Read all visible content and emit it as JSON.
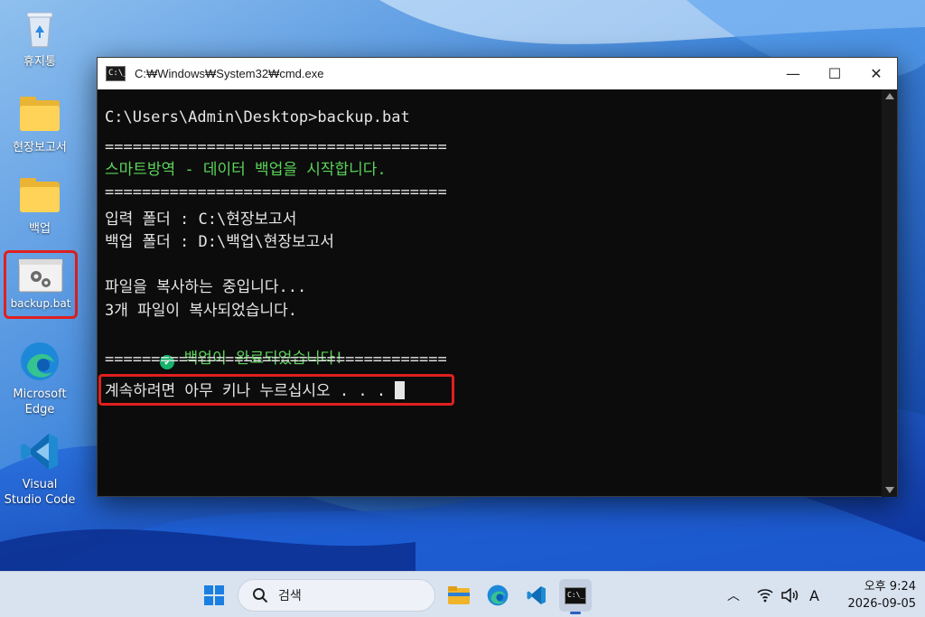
{
  "desktop": {
    "icons": [
      {
        "label": "휴지통",
        "glyph": "recycle-bin-icon"
      },
      {
        "label": "현장보고서",
        "glyph": "folder-icon"
      },
      {
        "label": "백업",
        "glyph": "folder-icon"
      },
      {
        "label": "backup.bat",
        "glyph": "batch-file-gears-icon",
        "selected": true
      },
      {
        "label": "Microsoft Edge",
        "glyph": "edge-icon"
      },
      {
        "label": "Visual Studio Code",
        "glyph": "vscode-icon"
      }
    ]
  },
  "window": {
    "title": "C:₩Windows₩System32₩cmd.exe",
    "icon_text": "C:\\_",
    "minimize_glyph": "—",
    "maximize_glyph": "☐",
    "close_glyph": "✕"
  },
  "terminal": {
    "prompt": "C:\\Users\\Admin\\Desktop>backup.bat",
    "separator": "=====================================",
    "banner": "스마트방역 - 데이터 백업을 시작합니다.",
    "input_folder": "입력 폴더 : C:\\현장보고서",
    "backup_folder": "백업 폴더 : D:\\백업\\현장보고서",
    "copying": "파일을 복사하는 중입니다...",
    "copied": "3개 파일이 복사되었습니다.",
    "done": "백업이 완료되었습니다!",
    "done_check": "✔",
    "continue_prompt": "계속하려면 아무 키나 누르십시오 . . . "
  },
  "taskbar": {
    "search_placeholder": "검색",
    "clock_time": "오후 9:24",
    "clock_date": "2026-09-05",
    "ime_indicator": "A",
    "tray_chevron": "︿"
  },
  "colors": {
    "terminal_bg": "#0c0c0c",
    "terminal_text": "#e6e6e6",
    "success_green": "#5ad45a",
    "highlight_red": "#e0201f",
    "taskbar_bg": "#d9e3f0"
  }
}
